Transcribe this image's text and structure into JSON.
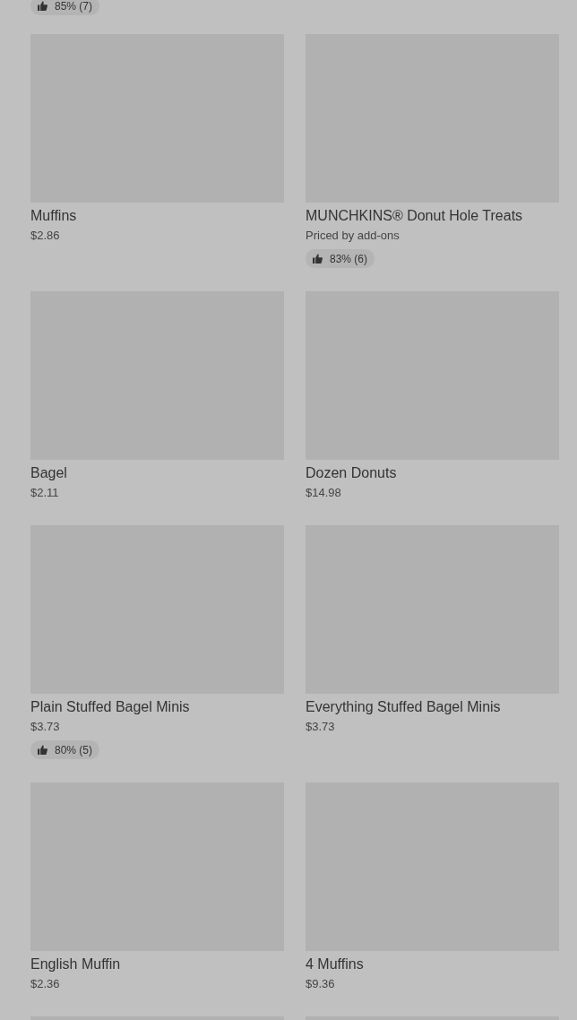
{
  "top_fragment": {
    "rating": "85% (7)"
  },
  "items": [
    {
      "name": "Muffins",
      "price": "$2.86"
    },
    {
      "name": "MUNCHKINS® Donut Hole Treats",
      "price": "Priced by add-ons",
      "rating": "83% (6)"
    },
    {
      "name": "Bagel",
      "price": "$2.11"
    },
    {
      "name": "Dozen Donuts",
      "price": "$14.98"
    },
    {
      "name": "Plain Stuffed Bagel Minis",
      "price": "$3.73",
      "rating": "80% (5)"
    },
    {
      "name": "Everything Stuffed Bagel Minis",
      "price": "$3.73"
    },
    {
      "name": "English Muffin",
      "price": "$2.36"
    },
    {
      "name": "4 Muffins",
      "price": "$9.36"
    }
  ],
  "cut_off_items": [
    {
      "kind": "image_only"
    },
    {
      "kind": "image_only"
    }
  ]
}
